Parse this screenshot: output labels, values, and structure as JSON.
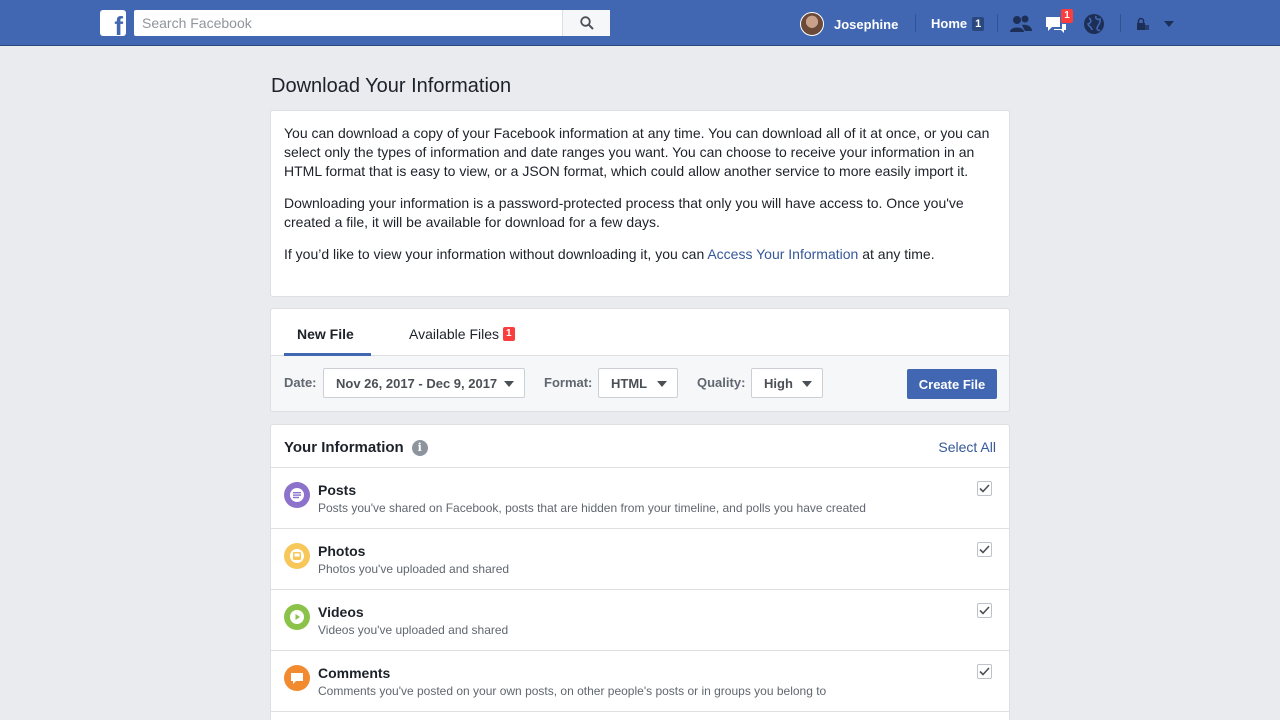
{
  "topbar": {
    "logo_letter": "f",
    "search_placeholder": "Search Facebook",
    "user_name": "Josephine",
    "home_label": "Home",
    "home_count": "1",
    "messages_count": "1",
    "brand_color": "#4267b2"
  },
  "page": {
    "title": "Download Your Information"
  },
  "intro": {
    "p1": "You can download a copy of your Facebook information at any time. You can download all of it at once, or you can select only the types of information and date ranges you want. You can choose to receive your information in an HTML format that is easy to view, or a JSON format, which could allow another service to more easily import it.",
    "p2": "Downloading your information is a password-protected process that only you will have access to. Once you've created a file, it will be available for download for a few days.",
    "p3_before": "If you’d like to view your information without downloading it, you can ",
    "p3_link": "Access Your Information",
    "p3_after": " at any time."
  },
  "tabs": {
    "new_file": "New File",
    "available_files": "Available Files",
    "available_count": "1"
  },
  "options": {
    "date_label": "Date:",
    "date_value": "Nov 26, 2017 - Dec 9, 2017",
    "format_label": "Format:",
    "format_value": "HTML",
    "quality_label": "Quality:",
    "quality_value": "High",
    "create_button": "Create File"
  },
  "info": {
    "title": "Your Information",
    "select_all": "Select All",
    "items": [
      {
        "title": "Posts",
        "desc": "Posts you've shared on Facebook, posts that are hidden from your timeline, and polls you have created",
        "icon": "posts-icon",
        "color": "#8c72cb",
        "checked": true
      },
      {
        "title": "Photos",
        "desc": "Photos you've uploaded and shared",
        "icon": "photos-icon",
        "color": "#f7c75a",
        "checked": true
      },
      {
        "title": "Videos",
        "desc": "Videos you've uploaded and shared",
        "icon": "videos-icon",
        "color": "#8bc34a",
        "checked": true
      },
      {
        "title": "Comments",
        "desc": "Comments you've posted on your own posts, on other people's posts or in groups you belong to",
        "icon": "comments-icon",
        "color": "#f28b30",
        "checked": true
      }
    ]
  }
}
